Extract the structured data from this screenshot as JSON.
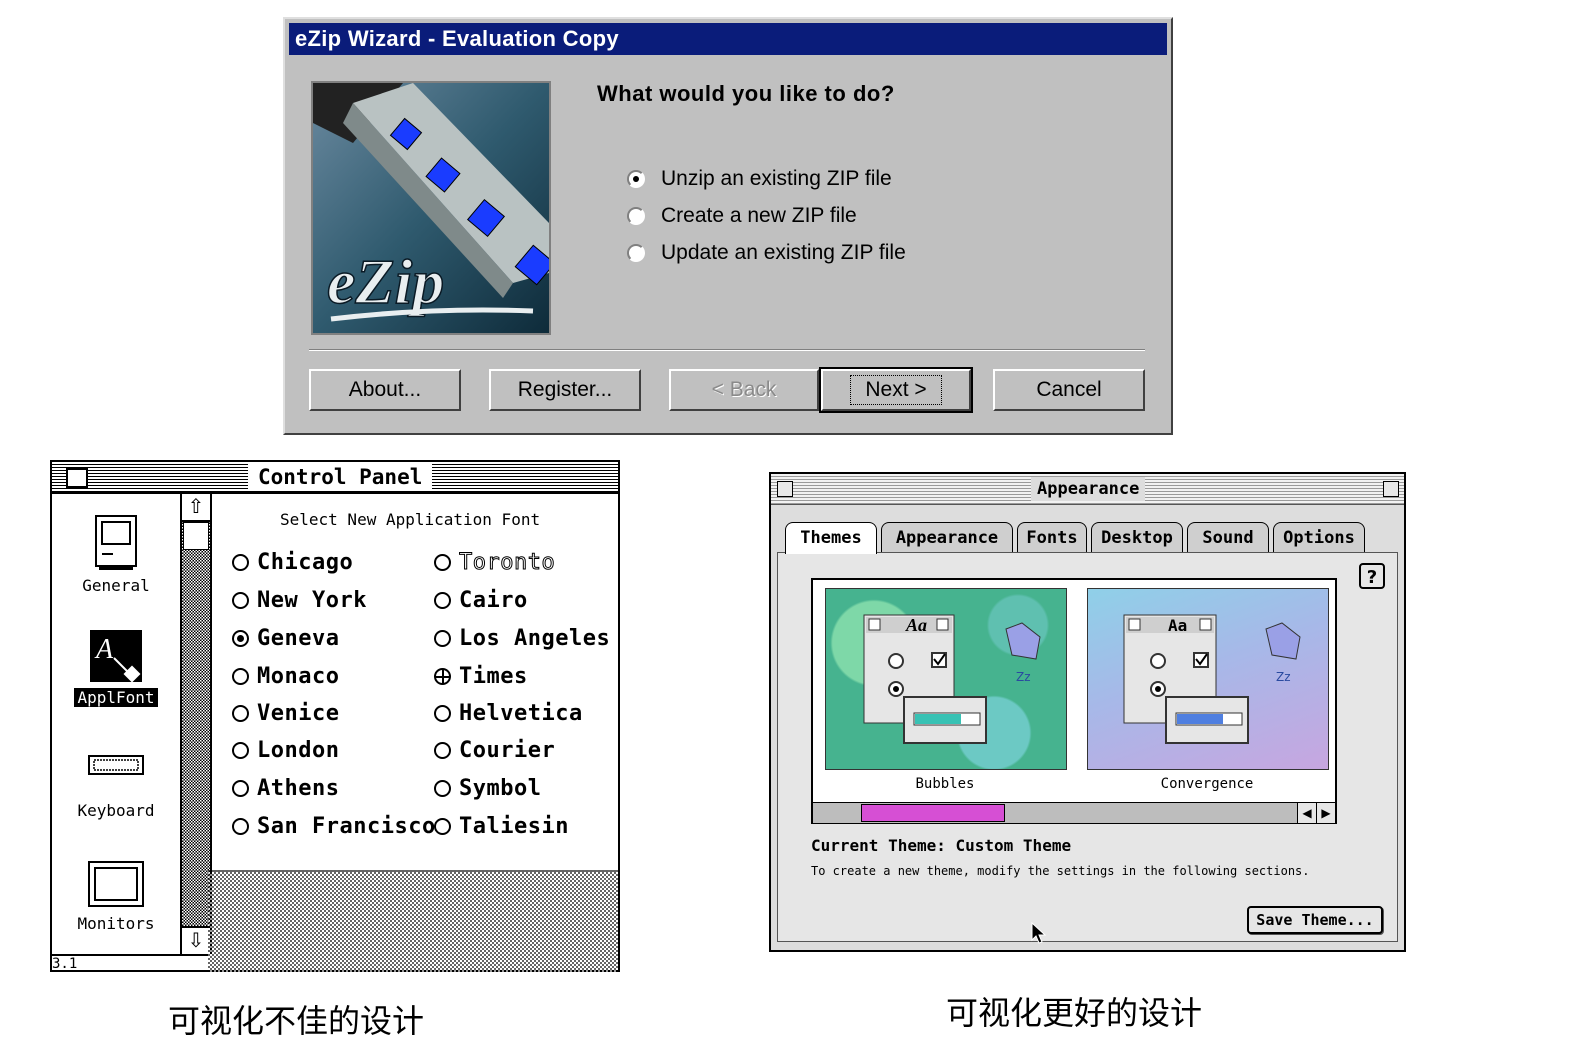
{
  "ezip": {
    "title": "eZip Wizard - Evaluation Copy",
    "logo_text": "eZip",
    "question": "What would you like to do?",
    "options": [
      {
        "label": "Unzip an existing ZIP file",
        "selected": true
      },
      {
        "label": "Create a new ZIP file",
        "selected": false
      },
      {
        "label": "Update an existing ZIP file",
        "selected": false
      }
    ],
    "buttons": {
      "about": "About...",
      "register": "Register...",
      "back": "< Back",
      "next": "Next >",
      "cancel": "Cancel"
    },
    "colors": {
      "titlebar": "#0a1c7a",
      "face": "#c0c0c0"
    }
  },
  "control_panel": {
    "title": "Control Panel",
    "subtitle": "Select New Application Font",
    "version": "3.1",
    "icons": [
      {
        "label": "General",
        "icon": "general-icon",
        "selected": false
      },
      {
        "label": "ApplFont",
        "icon": "font-icon",
        "selected": true
      },
      {
        "label": "Keyboard",
        "icon": "keyboard-icon",
        "selected": false
      },
      {
        "label": "Monitors",
        "icon": "monitor-icon",
        "selected": false
      }
    ],
    "fonts_left": [
      "Chicago",
      "New York",
      "Geneva",
      "Monaco",
      "Venice",
      "London",
      "Athens",
      "San Francisco"
    ],
    "fonts_right": [
      "Toronto",
      "Cairo",
      "Los Angeles",
      "Times",
      "Helvetica",
      "Courier",
      "Symbol",
      "Taliesin"
    ],
    "selected_font": "Geneva"
  },
  "appearance": {
    "title": "Appearance",
    "tabs": [
      "Themes",
      "Appearance",
      "Fonts",
      "Desktop",
      "Sound",
      "Options"
    ],
    "active_tab": "Themes",
    "themes": [
      {
        "name": "Bubbles",
        "sample_text": "Aa",
        "badge": "Zz"
      },
      {
        "name": "Convergence",
        "sample_text": "Aa",
        "badge": "Zz"
      }
    ],
    "current_theme": "Current Theme: Custom Theme",
    "description": "To create a new theme, modify the settings in the following sections.",
    "save_button": "Save Theme...",
    "help_label": "?",
    "colors": {
      "scroll_thumb": "#d64fd4"
    }
  },
  "captions": {
    "left": "可视化不佳的设计",
    "right": "可视化更好的设计"
  }
}
